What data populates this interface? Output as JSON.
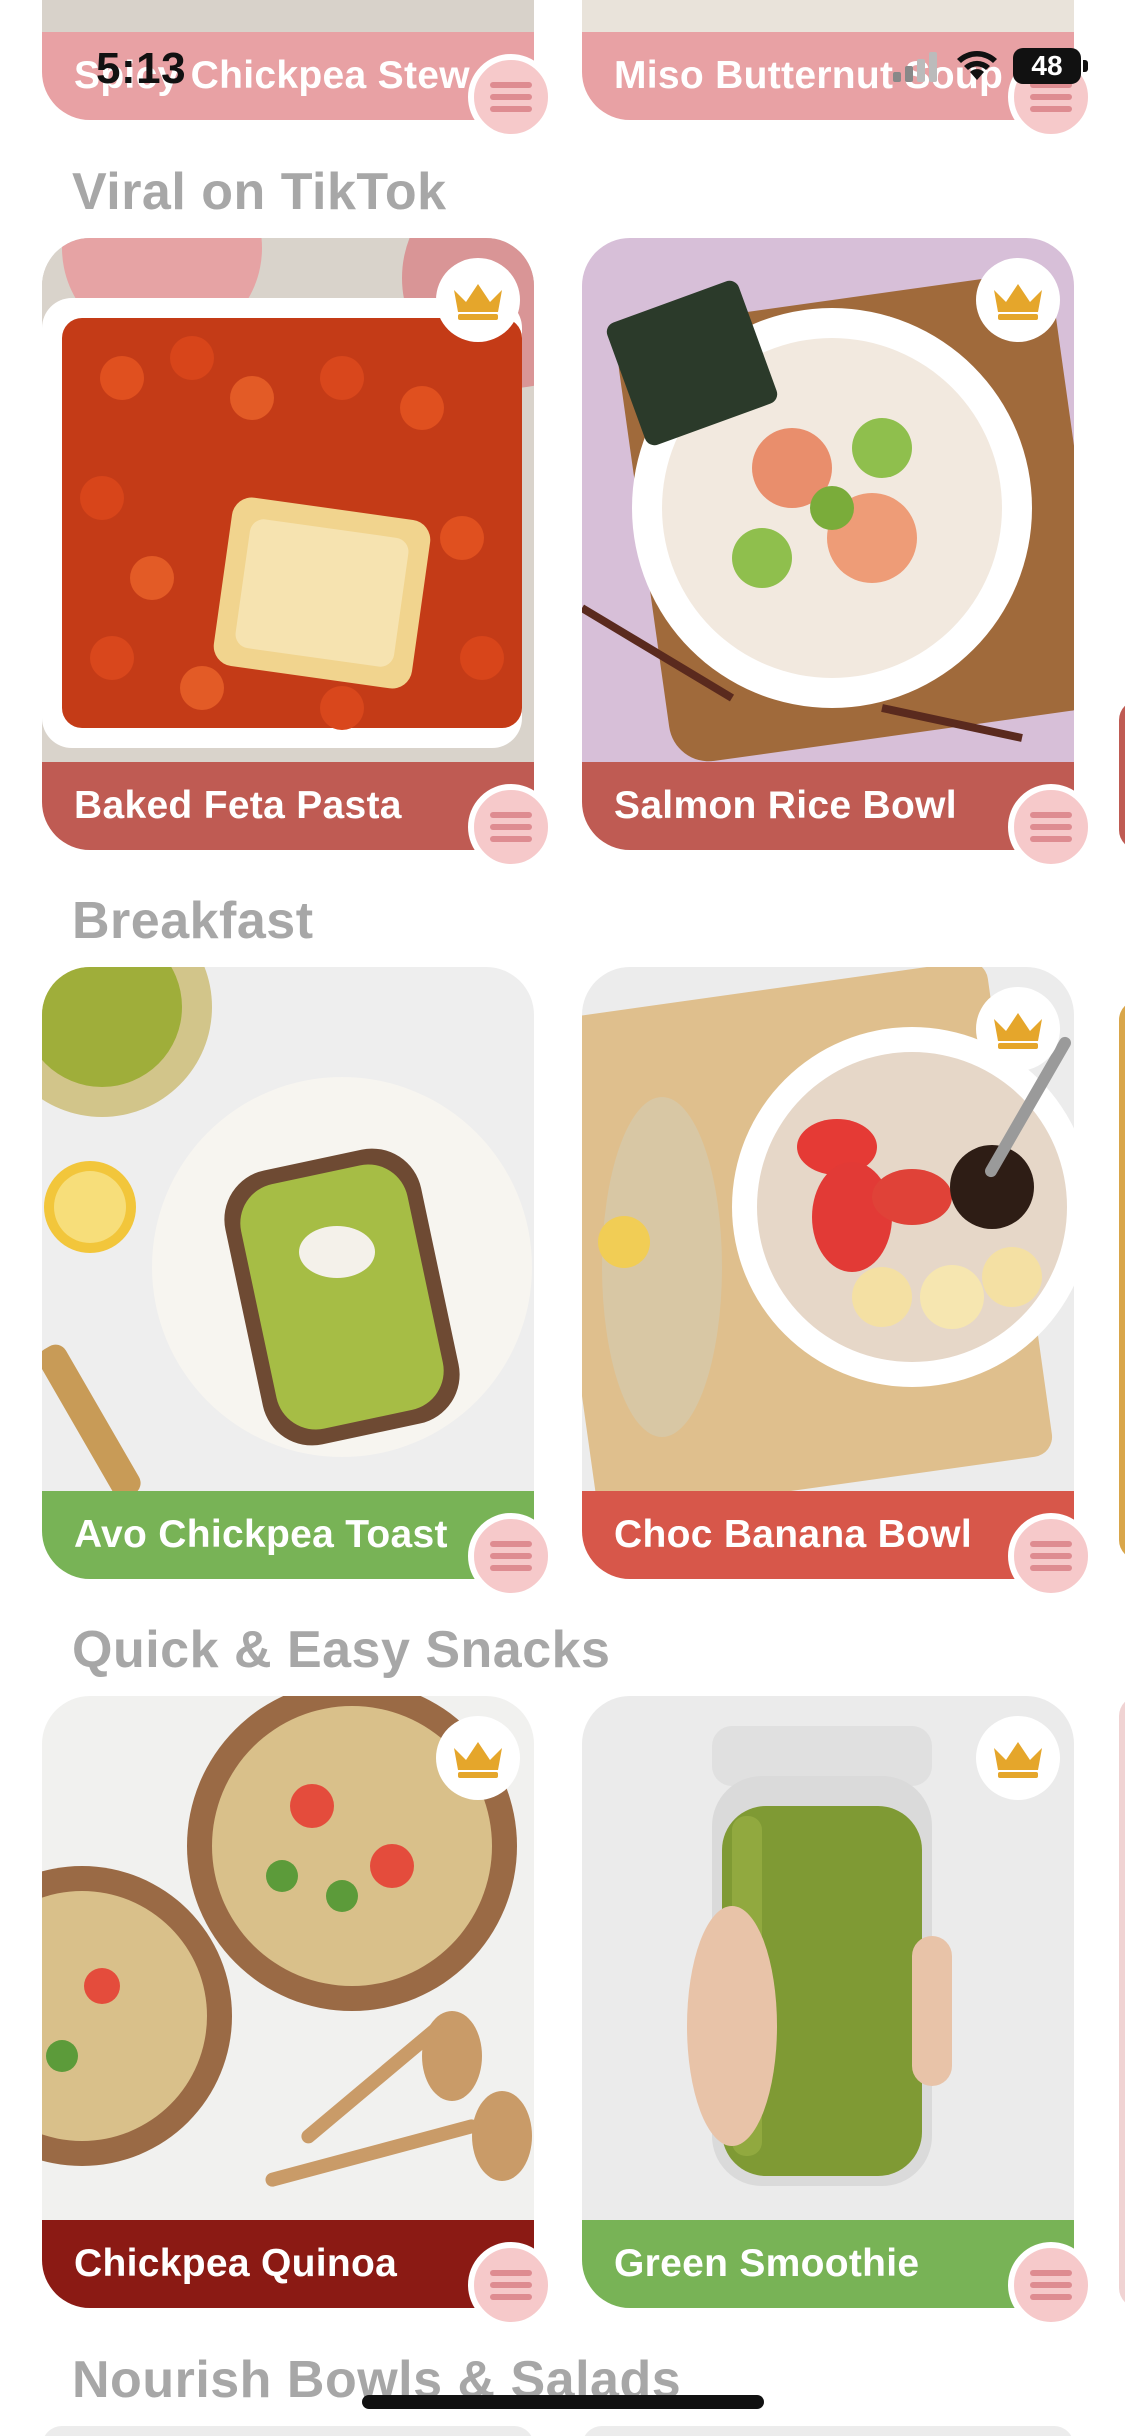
{
  "status": {
    "time": "5:13",
    "battery": "48"
  },
  "sections": [
    {
      "title": "Viral on TikTok"
    },
    {
      "title": "Breakfast"
    },
    {
      "title": "Quick & Easy Snacks"
    },
    {
      "title": "Nourish Bowls & Salads"
    }
  ],
  "top_cards": [
    {
      "title": "Spicy Chickpea Stew",
      "band_color": "#e8a1a4"
    },
    {
      "title": "Miso Butternut Soup",
      "band_color": "#e8a1a4"
    }
  ],
  "cards": [
    {
      "title": "Baked Feta Pasta",
      "band_color": "#bf5b53",
      "premium": true
    },
    {
      "title": "Salmon Rice Bowl",
      "band_color": "#bf5b53",
      "premium": true
    },
    {
      "title": "Avo Chickpea Toast",
      "band_color": "#78b356",
      "premium": false
    },
    {
      "title": "Choc Banana Bowl",
      "band_color": "#d7574a",
      "premium": true
    },
    {
      "title": "Chickpea Quinoa",
      "band_color": "#8b1a14",
      "premium": true
    },
    {
      "title": "Green Smoothie",
      "band_color": "#78b356",
      "premium": true
    }
  ],
  "colors": {
    "menu_button": "#f6c9ca",
    "crown": "#e5a62b",
    "section_title": "#a7a7a7"
  },
  "icons": {
    "crown": "crown-icon",
    "menu": "menu-lines-icon",
    "wifi": "wifi-icon",
    "signal": "signal-icon",
    "battery": "battery-icon"
  }
}
